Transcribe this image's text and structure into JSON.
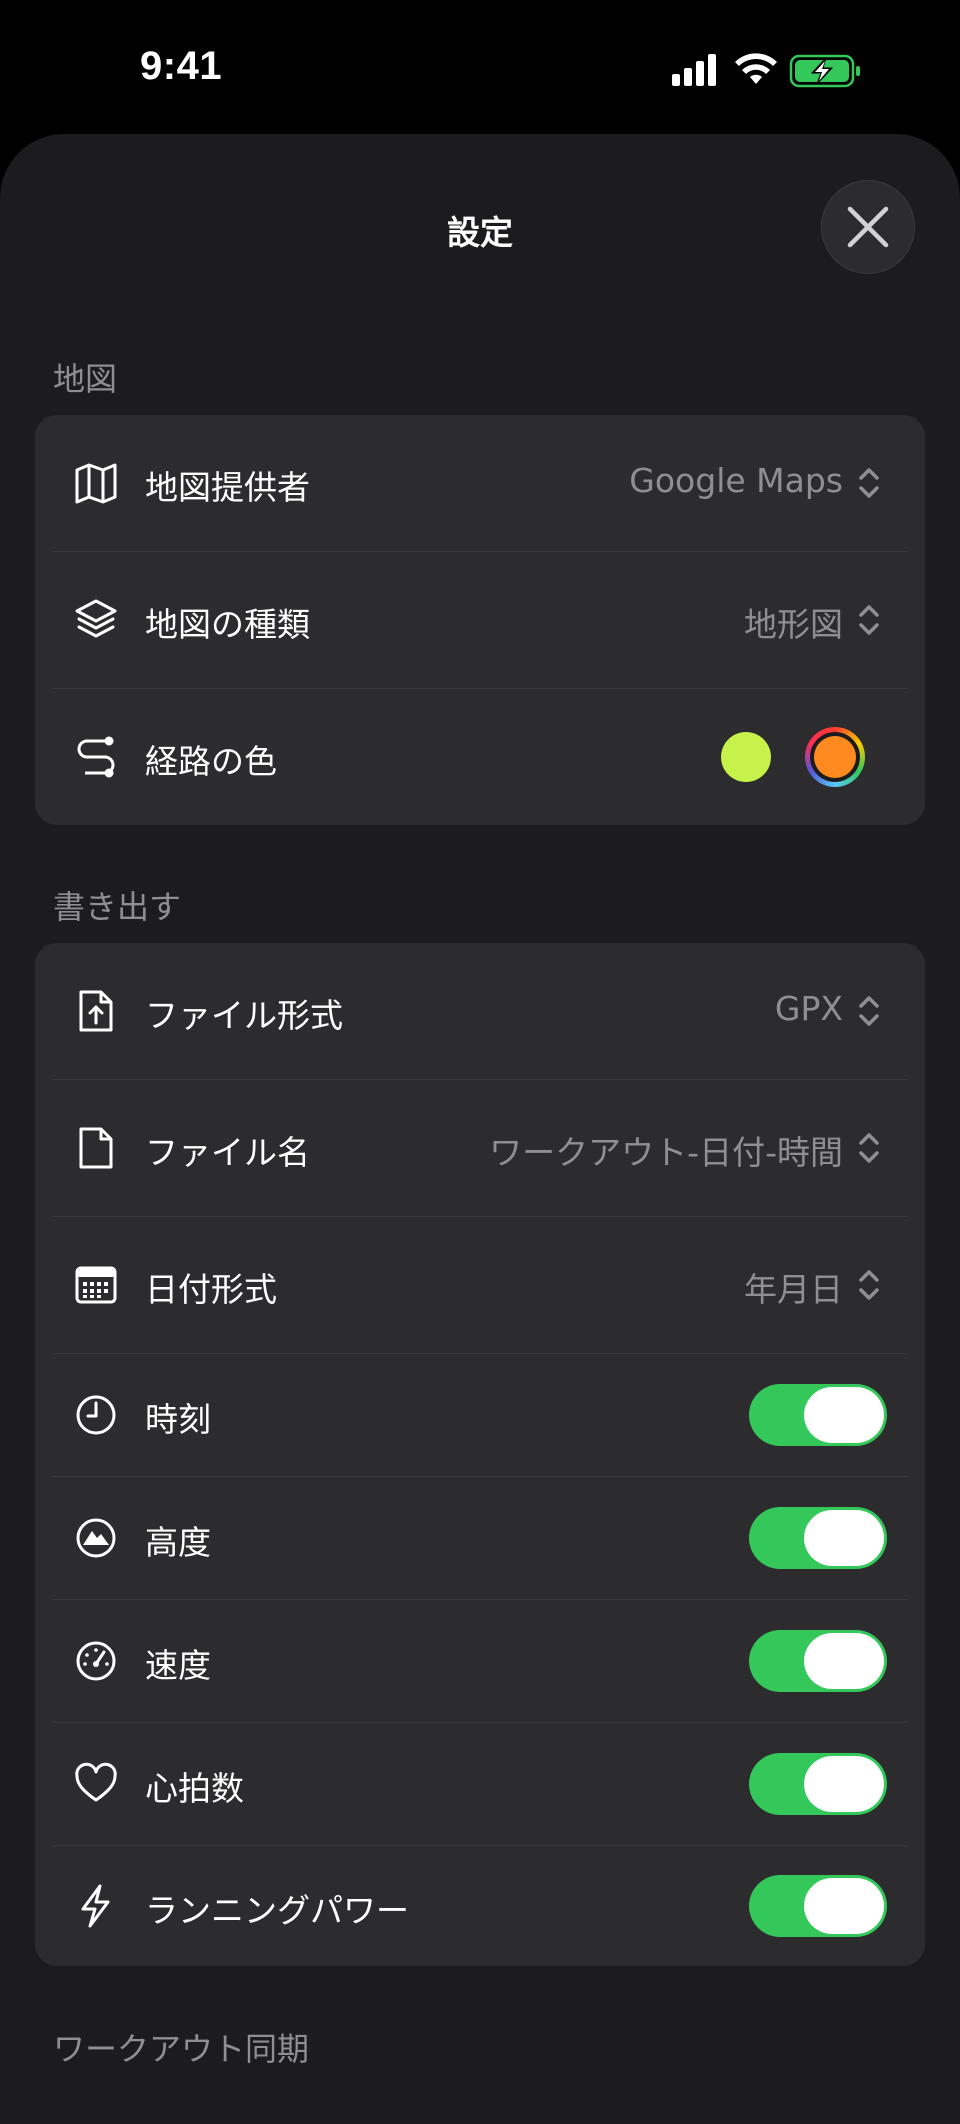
{
  "status_bar": {
    "time": "9:41"
  },
  "sheet": {
    "title": "設定"
  },
  "sections": {
    "map": {
      "header": "地図",
      "provider": {
        "label": "地図提供者",
        "value": "Google Maps",
        "icon": "map-icon"
      },
      "map_type": {
        "label": "地図の種類",
        "value": "地形図",
        "icon": "layers-icon"
      },
      "route_color": {
        "label": "経路の色",
        "icon": "route-icon",
        "swatch_color": "#c6f24a",
        "picker_color": "#ff8a1f"
      }
    },
    "export": {
      "header": "書き出す",
      "file_format": {
        "label": "ファイル形式",
        "value": "GPX",
        "icon": "file-export-icon"
      },
      "file_name": {
        "label": "ファイル名",
        "value": "ワークアウト-日付-時間",
        "icon": "document-icon"
      },
      "date_format": {
        "label": "日付形式",
        "value": "年月日",
        "icon": "calendar-icon"
      },
      "time": {
        "label": "時刻",
        "icon": "clock-icon",
        "on": true
      },
      "altitude": {
        "label": "高度",
        "icon": "mountain-icon",
        "on": true
      },
      "speed": {
        "label": "速度",
        "icon": "speedometer-icon",
        "on": true
      },
      "heart_rate": {
        "label": "心拍数",
        "icon": "heart-icon",
        "on": true
      },
      "running_power": {
        "label": "ランニングパワー",
        "icon": "bolt-icon",
        "on": true
      }
    },
    "sync": {
      "header": "ワークアウト同期"
    }
  },
  "colors": {
    "accent_toggle": "#34c759",
    "battery": "#34c759"
  }
}
